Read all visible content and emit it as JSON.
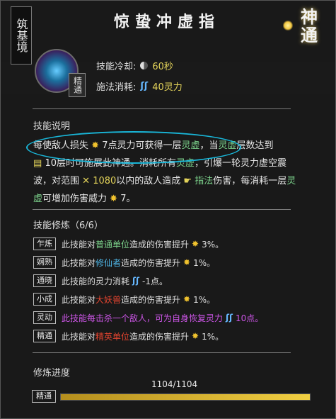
{
  "realm": "筑基境",
  "title": "惊蛰冲虚指",
  "corner_label": "神通",
  "mastery_tag": "精通",
  "stats": {
    "cooldown_label": "技能冷却:",
    "cooldown_value": "60秒",
    "cost_label": "施法消耗:",
    "cost_value": "40灵力"
  },
  "description": {
    "section_title": "技能说明",
    "seg1": "每使敌人损失 ",
    "seg2": "7点灵力可获得一层",
    "seg3": "灵虚",
    "seg4": "，当",
    "seg5": "灵虚",
    "seg6": "层数达到",
    "seg7": "10层时可施展此神通。消耗所有",
    "seg8": "灵虚",
    "seg9": "，引爆一轮灵力虚空震波，对范围 ",
    "seg10": "1080",
    "seg11": "以内的敌人造成 ",
    "seg12": "指法",
    "seg13": "伤害，每消耗一层",
    "seg14": "灵虚",
    "seg15": "可增加伤害威力 ",
    "seg16": "7。"
  },
  "refine": {
    "section_title": "技能修炼（6/6）",
    "rows": [
      {
        "tag": "乍炼",
        "a": "此技能对",
        "b": "普通单位",
        "c": "造成的伤害提升",
        "d": "3%。"
      },
      {
        "tag": "娴熟",
        "a": "此技能对",
        "b": "修仙者",
        "c": "造成的伤害提升",
        "d": "1%。"
      },
      {
        "tag": "通晓",
        "a": "此技能的灵力消耗",
        "b": "",
        "c": "",
        "d": "-1点。"
      },
      {
        "tag": "小成",
        "a": "此技能对",
        "b": "大妖兽",
        "c": "造成的伤害提升",
        "d": "1%。"
      },
      {
        "tag": "灵动",
        "a": "此技能每击杀一个敌人，可为自身恢复灵力",
        "b": "",
        "c": "",
        "d": "10点。"
      },
      {
        "tag": "精通",
        "a": "此技能对",
        "b": "精英单位",
        "c": "造成的伤害提升",
        "d": "1%。"
      }
    ]
  },
  "progress": {
    "section_title": "修炼进度",
    "tag": "精通",
    "text": "1104/1104",
    "fraction": 1.0
  },
  "colors": {
    "accent_gold": "#e4d45a",
    "highlight_green": "#7bd08a",
    "highlight_blue": "#4fb6e6",
    "highlight_red": "#e2442f",
    "highlight_purple": "#cc55e6",
    "annotation_circle": "#19b6d8"
  }
}
